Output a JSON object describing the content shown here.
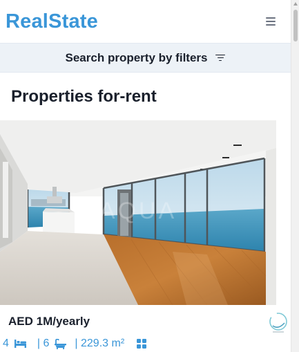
{
  "header": {
    "brand": "RealState",
    "menu_icon": "hamburger-menu-icon"
  },
  "filter_bar": {
    "label": "Search property by filters",
    "icon": "filter-icon"
  },
  "page": {
    "title": "Properties for-rent"
  },
  "listing": {
    "price": "AED 1M/yearly",
    "rooms": "4",
    "baths": "| 6",
    "area": "| 229.3 m²",
    "watermark": "AQUA",
    "icons": [
      "bed-icon",
      "bath-icon",
      "grid-icon"
    ]
  },
  "colors": {
    "brand": "#3a96d8",
    "filter_bg": "#edf2f7",
    "text": "#1a202c"
  }
}
